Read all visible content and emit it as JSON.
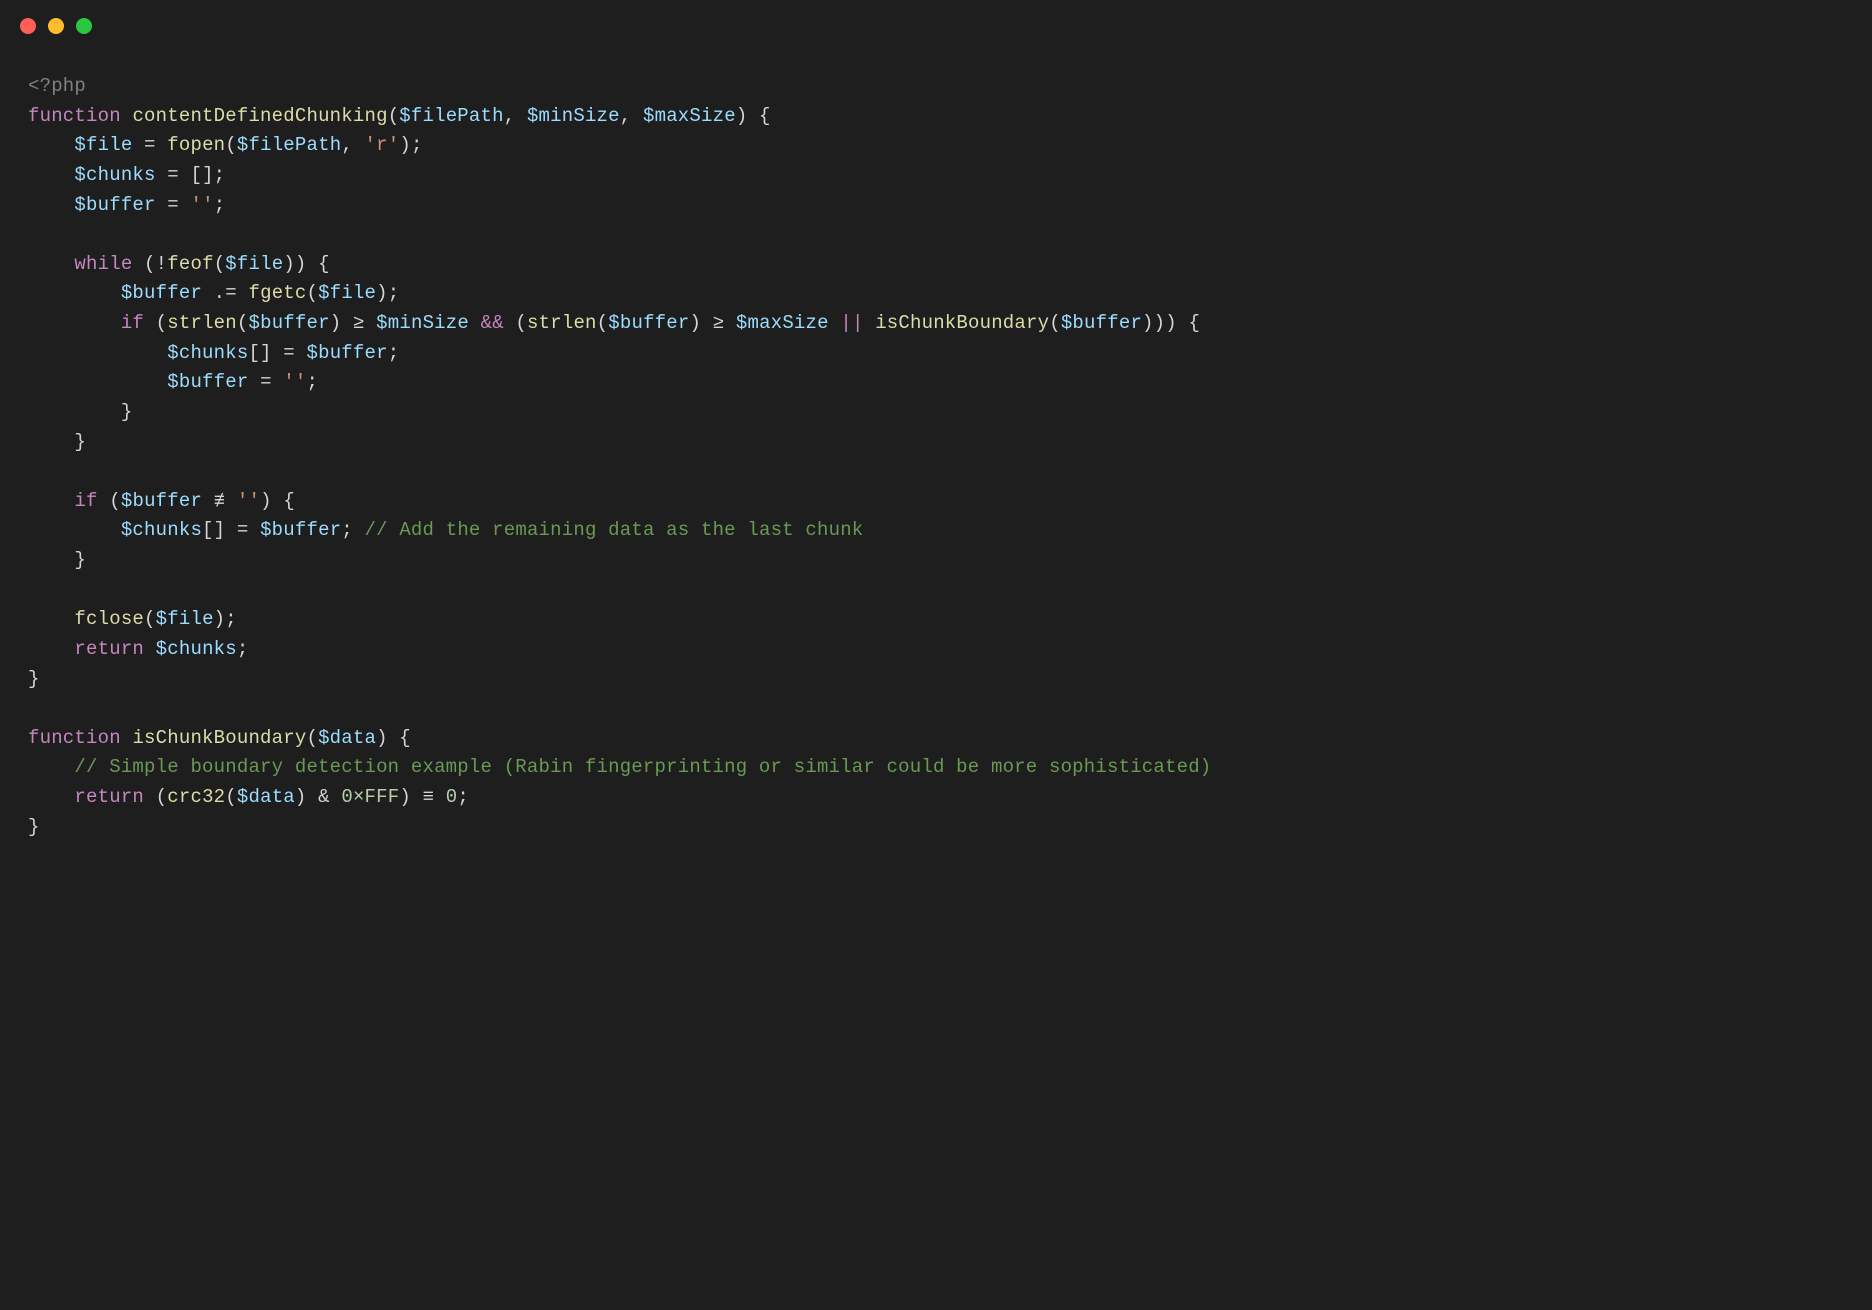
{
  "titlebar": {
    "buttons": [
      "close",
      "minimize",
      "zoom"
    ]
  },
  "code": {
    "lines": [
      [
        {
          "t": "tag",
          "v": "<?php"
        }
      ],
      [
        {
          "t": "keyword",
          "v": "function"
        },
        {
          "t": "plain",
          "v": " "
        },
        {
          "t": "funcname",
          "v": "contentDefinedChunking"
        },
        {
          "t": "punct",
          "v": "("
        },
        {
          "t": "var",
          "v": "$filePath"
        },
        {
          "t": "punct",
          "v": ", "
        },
        {
          "t": "var",
          "v": "$minSize"
        },
        {
          "t": "punct",
          "v": ", "
        },
        {
          "t": "var",
          "v": "$maxSize"
        },
        {
          "t": "punct",
          "v": ") {"
        }
      ],
      [
        {
          "t": "plain",
          "v": "    "
        },
        {
          "t": "var",
          "v": "$file"
        },
        {
          "t": "plain",
          "v": " "
        },
        {
          "t": "op",
          "v": "="
        },
        {
          "t": "plain",
          "v": " "
        },
        {
          "t": "call",
          "v": "fopen"
        },
        {
          "t": "punct",
          "v": "("
        },
        {
          "t": "var",
          "v": "$filePath"
        },
        {
          "t": "punct",
          "v": ", "
        },
        {
          "t": "string",
          "v": "'r'"
        },
        {
          "t": "punct",
          "v": ");"
        }
      ],
      [
        {
          "t": "plain",
          "v": "    "
        },
        {
          "t": "var",
          "v": "$chunks"
        },
        {
          "t": "plain",
          "v": " "
        },
        {
          "t": "op",
          "v": "="
        },
        {
          "t": "plain",
          "v": " "
        },
        {
          "t": "punct",
          "v": "[];"
        }
      ],
      [
        {
          "t": "plain",
          "v": "    "
        },
        {
          "t": "var",
          "v": "$buffer"
        },
        {
          "t": "plain",
          "v": " "
        },
        {
          "t": "op",
          "v": "="
        },
        {
          "t": "plain",
          "v": " "
        },
        {
          "t": "string",
          "v": "''"
        },
        {
          "t": "punct",
          "v": ";"
        }
      ],
      [
        {
          "t": "plain",
          "v": ""
        }
      ],
      [
        {
          "t": "plain",
          "v": "    "
        },
        {
          "t": "keyword",
          "v": "while"
        },
        {
          "t": "plain",
          "v": " "
        },
        {
          "t": "punct",
          "v": "("
        },
        {
          "t": "op",
          "v": "!"
        },
        {
          "t": "call",
          "v": "feof"
        },
        {
          "t": "punct",
          "v": "("
        },
        {
          "t": "var",
          "v": "$file"
        },
        {
          "t": "punct",
          "v": ")) {"
        }
      ],
      [
        {
          "t": "plain",
          "v": "        "
        },
        {
          "t": "var",
          "v": "$buffer"
        },
        {
          "t": "plain",
          "v": " "
        },
        {
          "t": "op",
          "v": ".="
        },
        {
          "t": "plain",
          "v": " "
        },
        {
          "t": "call",
          "v": "fgetc"
        },
        {
          "t": "punct",
          "v": "("
        },
        {
          "t": "var",
          "v": "$file"
        },
        {
          "t": "punct",
          "v": ");"
        }
      ],
      [
        {
          "t": "plain",
          "v": "        "
        },
        {
          "t": "keyword",
          "v": "if"
        },
        {
          "t": "plain",
          "v": " "
        },
        {
          "t": "punct",
          "v": "("
        },
        {
          "t": "call",
          "v": "strlen"
        },
        {
          "t": "punct",
          "v": "("
        },
        {
          "t": "var",
          "v": "$buffer"
        },
        {
          "t": "punct",
          "v": ") "
        },
        {
          "t": "op",
          "v": "≥"
        },
        {
          "t": "plain",
          "v": " "
        },
        {
          "t": "var",
          "v": "$minSize"
        },
        {
          "t": "plain",
          "v": " "
        },
        {
          "t": "logical",
          "v": "&&"
        },
        {
          "t": "plain",
          "v": " "
        },
        {
          "t": "punct",
          "v": "("
        },
        {
          "t": "call",
          "v": "strlen"
        },
        {
          "t": "punct",
          "v": "("
        },
        {
          "t": "var",
          "v": "$buffer"
        },
        {
          "t": "punct",
          "v": ") "
        },
        {
          "t": "op",
          "v": "≥"
        },
        {
          "t": "plain",
          "v": " "
        },
        {
          "t": "var",
          "v": "$maxSize"
        },
        {
          "t": "plain",
          "v": " "
        },
        {
          "t": "logical",
          "v": "||"
        },
        {
          "t": "plain",
          "v": " "
        },
        {
          "t": "call",
          "v": "isChunkBoundary"
        },
        {
          "t": "punct",
          "v": "("
        },
        {
          "t": "var",
          "v": "$buffer"
        },
        {
          "t": "punct",
          "v": "))) {"
        }
      ],
      [
        {
          "t": "plain",
          "v": "            "
        },
        {
          "t": "var",
          "v": "$chunks"
        },
        {
          "t": "punct",
          "v": "[] "
        },
        {
          "t": "op",
          "v": "="
        },
        {
          "t": "plain",
          "v": " "
        },
        {
          "t": "var",
          "v": "$buffer"
        },
        {
          "t": "punct",
          "v": ";"
        }
      ],
      [
        {
          "t": "plain",
          "v": "            "
        },
        {
          "t": "var",
          "v": "$buffer"
        },
        {
          "t": "plain",
          "v": " "
        },
        {
          "t": "op",
          "v": "="
        },
        {
          "t": "plain",
          "v": " "
        },
        {
          "t": "string",
          "v": "''"
        },
        {
          "t": "punct",
          "v": ";"
        }
      ],
      [
        {
          "t": "plain",
          "v": "        "
        },
        {
          "t": "punct",
          "v": "}"
        }
      ],
      [
        {
          "t": "plain",
          "v": "    "
        },
        {
          "t": "punct",
          "v": "}"
        }
      ],
      [
        {
          "t": "plain",
          "v": ""
        }
      ],
      [
        {
          "t": "plain",
          "v": "    "
        },
        {
          "t": "keyword",
          "v": "if"
        },
        {
          "t": "plain",
          "v": " "
        },
        {
          "t": "punct",
          "v": "("
        },
        {
          "t": "var",
          "v": "$buffer"
        },
        {
          "t": "plain",
          "v": " "
        },
        {
          "t": "op",
          "v": "≢"
        },
        {
          "t": "plain",
          "v": " "
        },
        {
          "t": "string",
          "v": "''"
        },
        {
          "t": "punct",
          "v": ") {"
        }
      ],
      [
        {
          "t": "plain",
          "v": "        "
        },
        {
          "t": "var",
          "v": "$chunks"
        },
        {
          "t": "punct",
          "v": "[] "
        },
        {
          "t": "op",
          "v": "="
        },
        {
          "t": "plain",
          "v": " "
        },
        {
          "t": "var",
          "v": "$buffer"
        },
        {
          "t": "punct",
          "v": "; "
        },
        {
          "t": "comment",
          "v": "// Add the remaining data as the last chunk"
        }
      ],
      [
        {
          "t": "plain",
          "v": "    "
        },
        {
          "t": "punct",
          "v": "}"
        }
      ],
      [
        {
          "t": "plain",
          "v": ""
        }
      ],
      [
        {
          "t": "plain",
          "v": "    "
        },
        {
          "t": "call",
          "v": "fclose"
        },
        {
          "t": "punct",
          "v": "("
        },
        {
          "t": "var",
          "v": "$file"
        },
        {
          "t": "punct",
          "v": ");"
        }
      ],
      [
        {
          "t": "plain",
          "v": "    "
        },
        {
          "t": "keyword",
          "v": "return"
        },
        {
          "t": "plain",
          "v": " "
        },
        {
          "t": "var",
          "v": "$chunks"
        },
        {
          "t": "punct",
          "v": ";"
        }
      ],
      [
        {
          "t": "punct",
          "v": "}"
        }
      ],
      [
        {
          "t": "plain",
          "v": ""
        }
      ],
      [
        {
          "t": "keyword",
          "v": "function"
        },
        {
          "t": "plain",
          "v": " "
        },
        {
          "t": "funcname",
          "v": "isChunkBoundary"
        },
        {
          "t": "punct",
          "v": "("
        },
        {
          "t": "var",
          "v": "$data"
        },
        {
          "t": "punct",
          "v": ") {"
        }
      ],
      [
        {
          "t": "plain",
          "v": "    "
        },
        {
          "t": "comment",
          "v": "// Simple boundary detection example (Rabin fingerprinting or similar could be more sophisticated)"
        }
      ],
      [
        {
          "t": "plain",
          "v": "    "
        },
        {
          "t": "keyword",
          "v": "return"
        },
        {
          "t": "plain",
          "v": " "
        },
        {
          "t": "punct",
          "v": "("
        },
        {
          "t": "call",
          "v": "crc32"
        },
        {
          "t": "punct",
          "v": "("
        },
        {
          "t": "var",
          "v": "$data"
        },
        {
          "t": "punct",
          "v": ") "
        },
        {
          "t": "op",
          "v": "&"
        },
        {
          "t": "plain",
          "v": " "
        },
        {
          "t": "num",
          "v": "0×FFF"
        },
        {
          "t": "punct",
          "v": ") "
        },
        {
          "t": "op",
          "v": "≡"
        },
        {
          "t": "plain",
          "v": " "
        },
        {
          "t": "num",
          "v": "0"
        },
        {
          "t": "punct",
          "v": ";"
        }
      ],
      [
        {
          "t": "punct",
          "v": "}"
        }
      ]
    ]
  }
}
